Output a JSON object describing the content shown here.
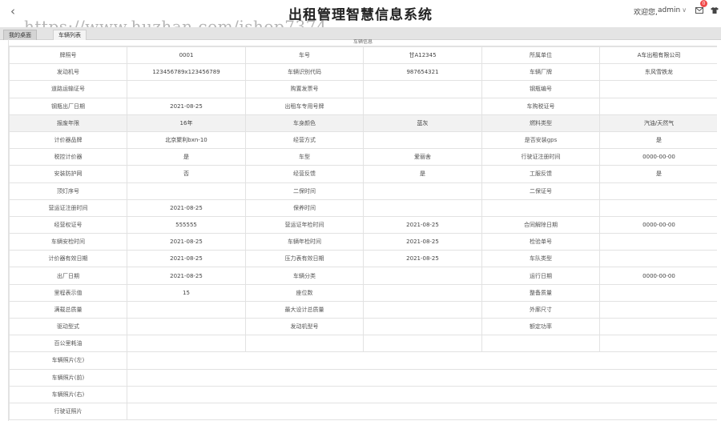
{
  "header": {
    "back_icon": "chevron-left-icon",
    "title": "出租管理智慧信息系统",
    "welcome": "欢迎您,",
    "username": "admin",
    "notification_count": "0"
  },
  "watermark": "https://www.huzhan.com/ishop7374",
  "tabs": [
    {
      "label": "我的桌面"
    },
    {
      "label": "车辆列表"
    }
  ],
  "section_title": "车辆信息",
  "rows": [
    {
      "shade": false,
      "cells": [
        "牌照号",
        "0001",
        "车号",
        "甘A12345",
        "所属单位",
        "A车出租有限公司"
      ]
    },
    {
      "shade": false,
      "cells": [
        "发动机号",
        "123456789x123456789",
        "车辆识别代码",
        "987654321",
        "车辆厂牌",
        "东风雪铁龙"
      ]
    },
    {
      "shade": false,
      "cells": [
        "道路运输证号",
        "",
        "购置发票号",
        "",
        "钢瓶编号",
        ""
      ]
    },
    {
      "shade": false,
      "cells": [
        "钢瓶出厂日期",
        "2021-08-25",
        "出租车专用号牌",
        "",
        "车购税证号",
        ""
      ]
    },
    {
      "shade": true,
      "cells": [
        "报废年限",
        "16年",
        "车身颜色",
        "蓝灰",
        "燃料类型",
        "汽油/天然气"
      ]
    },
    {
      "shade": false,
      "cells": [
        "计价器品牌",
        "北京聚利bxn-10",
        "经营方式",
        "",
        "是否安装gps",
        "是"
      ]
    },
    {
      "shade": false,
      "cells": [
        "税控计价器",
        "是",
        "车型",
        "爱丽舍",
        "行驶证注册时间",
        "0000-00-00"
      ]
    },
    {
      "shade": false,
      "cells": [
        "安装防护网",
        "否",
        "经营反馈",
        "是",
        "工服反馈",
        "是"
      ]
    },
    {
      "shade": false,
      "cells": [
        "顶灯序号",
        "",
        "二保时间",
        "",
        "二保证号",
        ""
      ]
    },
    {
      "shade": false,
      "cells": [
        "营运证注册时间",
        "2021-08-25",
        "保养时间",
        "",
        "",
        ""
      ]
    },
    {
      "shade": false,
      "cells": [
        "经营权证号",
        "555555",
        "营运证年检时间",
        "2021-08-25",
        "合同解除日期",
        "0000-00-00"
      ]
    },
    {
      "shade": false,
      "cells": [
        "车辆安检时间",
        "2021-08-25",
        "车辆年检时间",
        "2021-08-25",
        "检验单号",
        ""
      ]
    },
    {
      "shade": false,
      "cells": [
        "计价器有效日期",
        "2021-08-25",
        "压力表有效日期",
        "2021-08-25",
        "车队类型",
        ""
      ]
    },
    {
      "shade": false,
      "cells": [
        "出厂日期",
        "2021-08-25",
        "车辆分类",
        "",
        "运行日期",
        "0000-00-00"
      ]
    },
    {
      "shade": false,
      "cells": [
        "里程表示值",
        "15",
        "座位数",
        "",
        "整备质量",
        ""
      ]
    },
    {
      "shade": false,
      "cells": [
        "满载总质量",
        "",
        "最大设计总质量",
        "",
        "外廓尺寸",
        ""
      ]
    },
    {
      "shade": false,
      "cells": [
        "驱动型式",
        "",
        "发动机型号",
        "",
        "额定功率",
        ""
      ]
    },
    {
      "shade": false,
      "cells": [
        "百公里耗油",
        "",
        "",
        "",
        "",
        ""
      ]
    },
    {
      "shade": false,
      "span": true,
      "cells": [
        "车辆照片(左)",
        ""
      ]
    },
    {
      "shade": false,
      "span": true,
      "cells": [
        "车辆照片(前)",
        ""
      ]
    },
    {
      "shade": false,
      "span": true,
      "cells": [
        "车辆照片(右)",
        ""
      ]
    },
    {
      "shade": false,
      "span": true,
      "cells": [
        "行驶证照片",
        ""
      ]
    }
  ]
}
